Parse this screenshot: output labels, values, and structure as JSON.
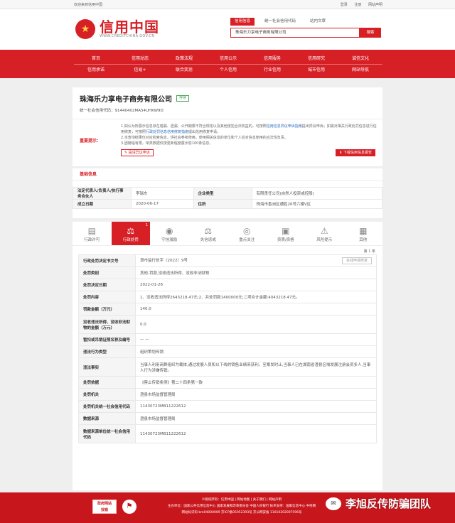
{
  "topbar": {
    "welcome": "欢迎来到信用中国",
    "links": [
      "登录",
      "注册",
      "网站声明"
    ]
  },
  "logo": {
    "title": "信用中国",
    "url": "WWW.CREDITCHINA.GOV.CN",
    "emblem": "★"
  },
  "search": {
    "tabs": [
      "信用信息",
      "统一社会信用代码",
      "站内文章"
    ],
    "value": "珠海乐力享电子商务有限公司",
    "button": "搜索"
  },
  "nav": {
    "row1": [
      "首页",
      "信用动态",
      "政策法规",
      "信用公示",
      "信用服务",
      "信用研究",
      "诚信文化"
    ],
    "row2": [
      "信用承诺",
      "信易+",
      "联合奖惩",
      "个人信用",
      "行业信用",
      "城市信用",
      "网站导航"
    ]
  },
  "company": {
    "name": "珠海乐力享电子商务有限公司",
    "status": "存续",
    "credit_code": "统一社会信用代码：91440402MA54UHKW9D"
  },
  "notice": {
    "label": "重要提示：",
    "line1a": "1.如认为所展示信息存在错漏、遗漏、公开期限不符合规定以及其他侵犯合法权益的，可按照",
    "line1link": "信用信息异议申诉指南",
    "line1b": "提出异议申诉；如需对相关行政处罚信息进行信用修复，可按照",
    "line1link2": "行政处罚信息信用修复指南",
    "line1c": "提出信用修复申请。",
    "line2": "2.本查询结果仅对应检索信息，供社会参考使用。使用相关信息的单位和个人应对信息使用的合法性负责。",
    "line3": "3.因篇幅有限，单类数据仅按更新程度展示前100条信息。",
    "objection_button": "提请异议申诉",
    "download_button": "下载信用信息报告"
  },
  "basic": {
    "title": "基础信息",
    "rows": [
      {
        "k1": "法定代表人/负责人/执行事务合伙人",
        "v1": "李瑞东",
        "k2": "企业类型",
        "v2": "有限责任公司(自然人投资或控股)"
      },
      {
        "k1": "成立日期",
        "v1": "2020-06-17",
        "k2": "住所",
        "v2": "珠海市香洲区通胜26号六楼V区"
      }
    ]
  },
  "tabs": [
    {
      "label": "行政许可",
      "icon": "▤",
      "count": ""
    },
    {
      "label": "行政处罚",
      "icon": "⚖",
      "count": "1"
    },
    {
      "label": "守信激励",
      "icon": "◉",
      "count": ""
    },
    {
      "label": "失信惩戒",
      "icon": "⚖",
      "count": ""
    },
    {
      "label": "重点关注",
      "icon": "◎",
      "count": ""
    },
    {
      "label": "资质/资格",
      "icon": "▣",
      "count": ""
    },
    {
      "label": "风险提示",
      "icon": "⚠",
      "count": ""
    },
    {
      "label": "其他",
      "icon": "▦",
      "count": ""
    }
  ],
  "page_info": "第 1 条",
  "penalty": {
    "history_button": "在线申请修复",
    "rows": [
      {
        "k": "行政处罚决定书文号",
        "v": "澄市监行处字〔2022〕9号"
      },
      {
        "k": "处罚类别",
        "v": "其他-罚款,没收违法所得、没收非法财物"
      },
      {
        "k": "处罚决定日期",
        "v": "2022-01-26"
      },
      {
        "k": "处罚内容",
        "v": "1、没收违法所得2643218.47元;2、并处罚款1400000元;二项合计金额:4043218.47元。"
      },
      {
        "k": "罚款金额（万元）",
        "v": "140.0"
      },
      {
        "k": "没收违法所得、没收非法财物的金额（万元）",
        "v": "0.0"
      },
      {
        "k": "暂扣或吊销证照名称及编号",
        "v": "— —"
      },
      {
        "k": "违法行为类型",
        "v": "组织策划传销"
      },
      {
        "k": "违法事实",
        "v": "当事人利用商群组织为载体,通过发展人员和以下线的销售业绩来获利。至案发时止,当事人已在湖南省澄县区域发展注册会员多人,当事人行为涉嫌传销。"
      },
      {
        "k": "处罚依据",
        "v": "《禁止传销条例》第二十四条第一款"
      },
      {
        "k": "处罚机关",
        "v": "澄县市场监督管理局"
      },
      {
        "k": "处罚机关统一社会信用代码",
        "v": "11430723MB11222612"
      },
      {
        "k": "数据来源",
        "v": "澄县市场监督管理局"
      },
      {
        "k": "数据来源单位统一社会信用代码",
        "v": "11430723MB11222612"
      }
    ]
  },
  "footer": {
    "badge1a": "政府网站",
    "badge1b": "找错",
    "badge2": "⚑",
    "line1": "©版权所有：信用中国 | 网站地图 | 关于我们 | 网站声明",
    "line2": "主办单位：国家公共信用信息中心  国家发展和改革委员会 中国人民银行  技术支持：国家信息中心 中经网",
    "line3": "网站标识码 bm04000009 京ICP备05052393号 京公网安备 11010202007596号"
  },
  "watermark": {
    "text": "李旭反传防骗团队",
    "icon": "✉"
  }
}
